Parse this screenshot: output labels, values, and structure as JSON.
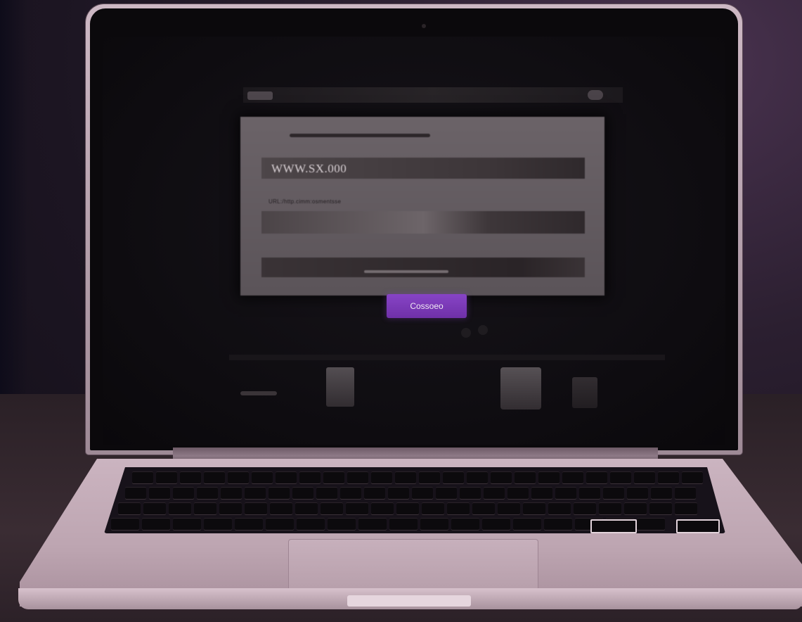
{
  "screen": {
    "url_text": "WWW.SX.000",
    "field_label": "URL:/http.cimm:osmentsse",
    "button_label": "Cossoeo"
  },
  "colors": {
    "button_accent": "#7b3bb8",
    "laptop_body": "#c4adb9",
    "screen_background": "#0e0c10",
    "backdrop": "#2b1f30"
  },
  "icons": {
    "camera": "camera-icon",
    "app_left": "menu-app-icon",
    "app_right": "menu-status-icon"
  }
}
